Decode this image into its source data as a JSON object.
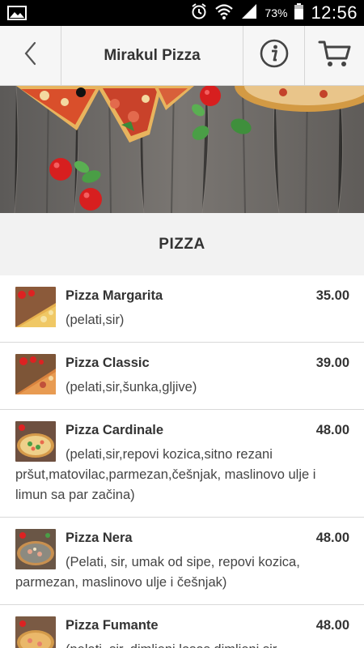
{
  "status_bar": {
    "battery_percent": "73%",
    "time": "12:56",
    "icons": [
      "image-notification-icon",
      "alarm-icon",
      "wifi-icon",
      "signal-icon",
      "battery-icon"
    ]
  },
  "app_bar": {
    "title": "Mirakul Pizza",
    "icons": {
      "back": "chevron-left-icon",
      "info": "info-icon",
      "cart": "cart-icon"
    }
  },
  "category": {
    "title": "PIZZA"
  },
  "menu": {
    "items": [
      {
        "name": "Pizza Margarita",
        "price": "35.00",
        "description": "(pelati,sir)"
      },
      {
        "name": "Pizza Classic",
        "price": "39.00",
        "description": "(pelati,sir,šunka,gljive)"
      },
      {
        "name": "Pizza Cardinale",
        "price": "48.00",
        "description": "(pelati,sir,repovi kozica,sitno rezani pršut,matovilac,parmezan,češnjak, maslinovo ulje i limun sa par začina)"
      },
      {
        "name": "Pizza Nera",
        "price": "48.00",
        "description": "(Pelati, sir, umak od sipe, repovi kozica, parmezan, maslinovo ulje i češnjak)"
      },
      {
        "name": "Pizza Fumante",
        "price": "48.00",
        "description": "(pelati, sir, dimljeni losos,dimljeni sir"
      }
    ]
  },
  "colors": {
    "status_bar_bg": "#000000",
    "app_bar_bg": "#f6f6f6",
    "category_bg": "#f2f2f2",
    "text_dark": "#333333",
    "divider": "#d9d9d9"
  }
}
